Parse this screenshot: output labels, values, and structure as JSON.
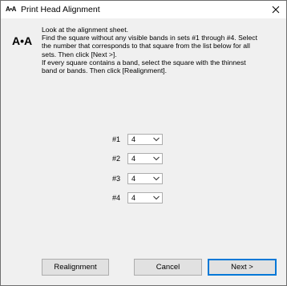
{
  "window": {
    "title": "Print Head Alignment",
    "app_icon_text": "A•A"
  },
  "main": {
    "icon_text": "A•A",
    "instructions": [
      "Look at the alignment sheet.",
      "Find the square without any visible bands in sets #1 through #4. Select",
      "the number that corresponds to that square from the list below for all",
      "sets. Then click [Next >].",
      "If every square contains a band, select the square with the thinnest",
      "band or bands. Then click [Realignment]."
    ],
    "sets": [
      {
        "label": "#1",
        "value": "4"
      },
      {
        "label": "#2",
        "value": "4"
      },
      {
        "label": "#3",
        "value": "4"
      },
      {
        "label": "#4",
        "value": "4"
      }
    ]
  },
  "footer": {
    "realignment_label": "Realignment",
    "cancel_label": "Cancel",
    "next_label": "Next >"
  }
}
